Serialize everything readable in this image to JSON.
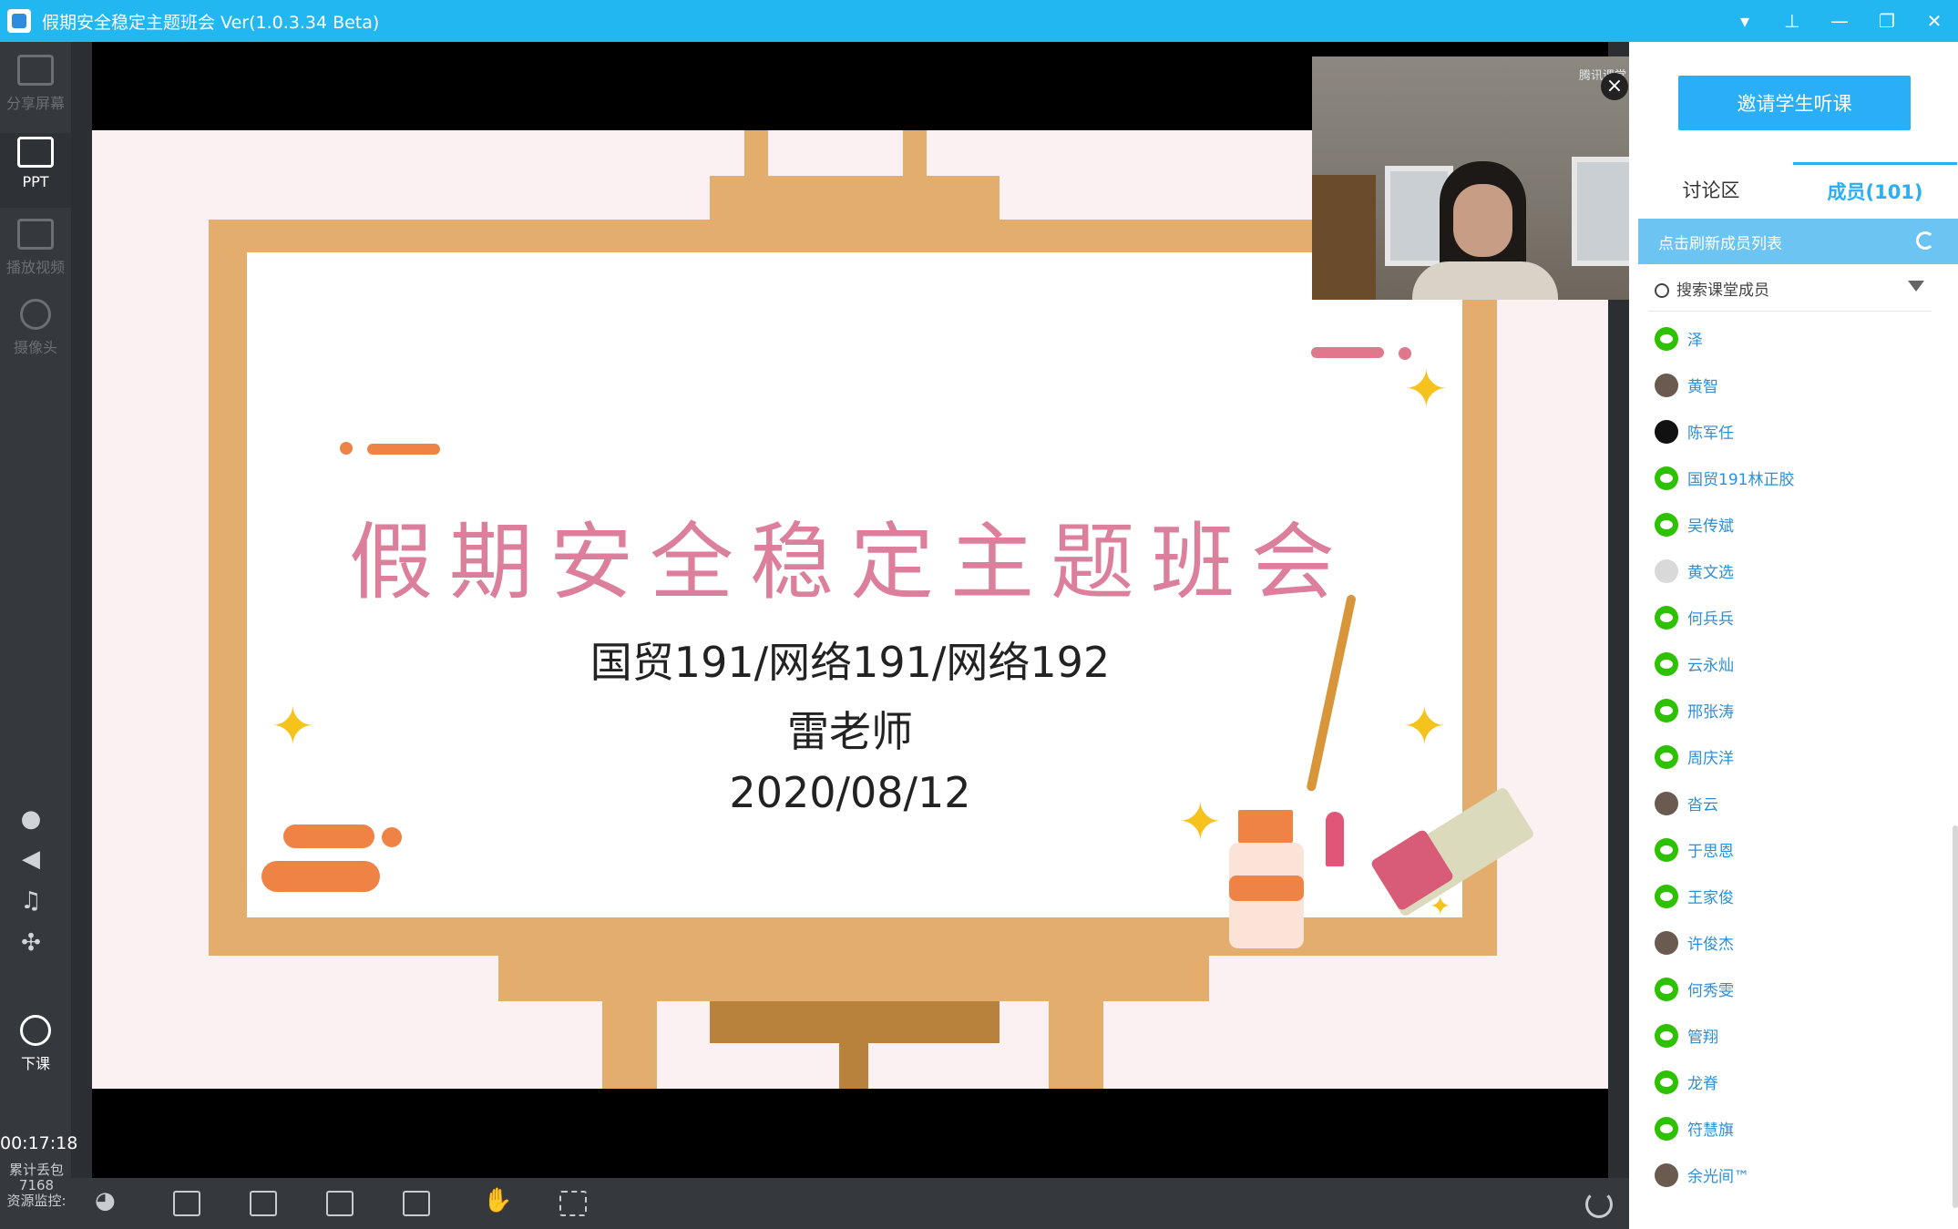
{
  "window": {
    "title": "假期安全稳定主题班会 Ver(1.0.3.34 Beta)",
    "controls": [
      "▾",
      "⊥",
      "—",
      "❐",
      "✕"
    ]
  },
  "left_toolbar": {
    "items": [
      {
        "label": "分享屏幕"
      },
      {
        "label": "PPT"
      },
      {
        "label": "播放视频"
      },
      {
        "label": "摄像头"
      }
    ],
    "end_class": "下课",
    "timer": "00:17:18",
    "packet_loss_label": "累计丢包",
    "packet_loss_value": "7168",
    "resource_monitor": "资源监控:"
  },
  "slide": {
    "title": "假期安全稳定主题班会",
    "classes": "国贸191/网络191/网络192",
    "teacher": "雷老师",
    "date": "2020/08/12"
  },
  "video": {
    "watermark": "腾讯课堂"
  },
  "right_panel": {
    "invite_button": "邀请学生听课",
    "tabs": [
      {
        "label": "讨论区"
      },
      {
        "label": "成员(101)"
      }
    ],
    "refresh_label": "点击刷新成员列表",
    "search_placeholder": "搜索课堂成员",
    "members": [
      {
        "name": "泽",
        "avatar": "wechat"
      },
      {
        "name": "黄智",
        "avatar": "photo"
      },
      {
        "name": "陈军任",
        "avatar": "qq"
      },
      {
        "name": "国贸191林正胶",
        "avatar": "wechat"
      },
      {
        "name": "吴传斌",
        "avatar": "wechat"
      },
      {
        "name": "黄文选",
        "avatar": "blank"
      },
      {
        "name": "何兵兵",
        "avatar": "wechat"
      },
      {
        "name": "云永灿",
        "avatar": "wechat"
      },
      {
        "name": "邢张涛",
        "avatar": "wechat"
      },
      {
        "name": "周庆洋",
        "avatar": "wechat"
      },
      {
        "name": "沓云",
        "avatar": "photo"
      },
      {
        "name": "于思恩",
        "avatar": "wechat"
      },
      {
        "name": "王家俊",
        "avatar": "wechat"
      },
      {
        "name": "许俊杰",
        "avatar": "photo"
      },
      {
        "name": "何秀雯",
        "avatar": "wechat"
      },
      {
        "name": "管翔",
        "avatar": "wechat"
      },
      {
        "name": "龙脊",
        "avatar": "wechat"
      },
      {
        "name": "符慧旗",
        "avatar": "wechat"
      },
      {
        "name": "余光间™",
        "avatar": "photo"
      }
    ]
  },
  "colors": {
    "titlebar": "#23b7f2",
    "accent": "#2aaef5",
    "slide_title": "#db7f9c",
    "easel_wood": "#e3ad6e"
  }
}
